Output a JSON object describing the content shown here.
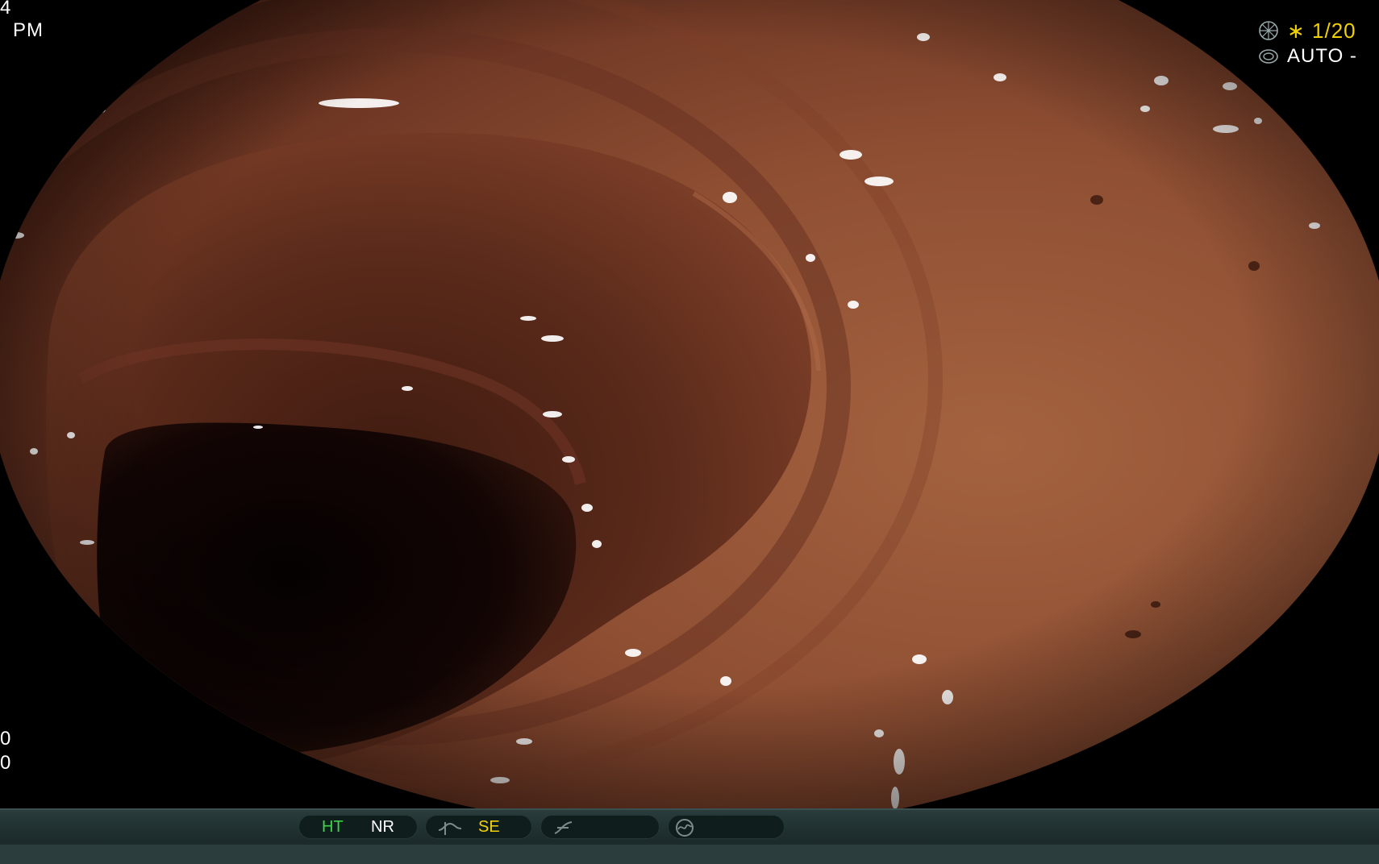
{
  "overlay": {
    "top_left_line1": "4",
    "top_left_line2": "PM",
    "bottom_left_line1": "0",
    "bottom_left_line2": "0"
  },
  "top_right": {
    "shutter_icon": "aperture-icon",
    "shutter_value": "∗ 1/20",
    "mode_icon": "iris-icon",
    "mode_value": "AUTO -"
  },
  "status_bar": {
    "ht_label": "HT",
    "nr_label": "NR",
    "se_icon": "tone-curve-icon",
    "se_label": "SE",
    "enhance_icon": "enhance-curve-icon",
    "color_icon": "color-mode-icon"
  },
  "colors": {
    "ht_active": "#3fd24a",
    "se_active": "#f2d20a",
    "shutter_text": "#f0d000",
    "mucosa": "#8a4a30",
    "lumen": "#0a0302"
  }
}
